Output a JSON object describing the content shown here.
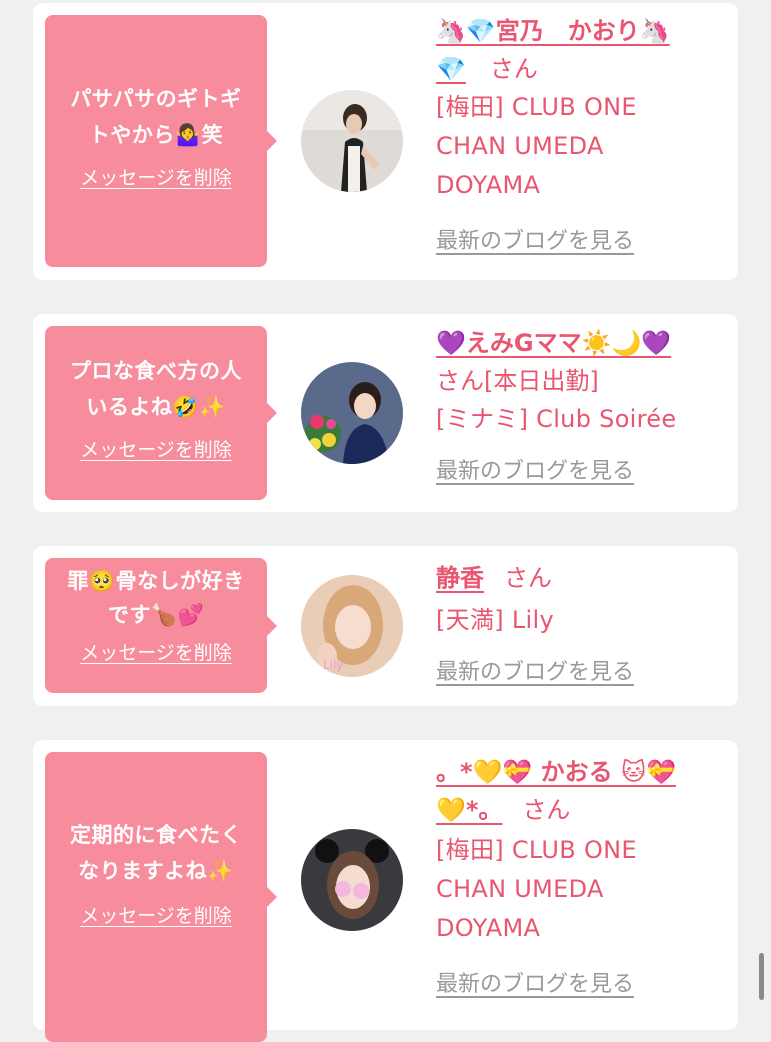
{
  "messages": [
    {
      "comment_lines": [
        "パサパサのギトギ",
        "トやから🤷‍♀️笑"
      ],
      "delete_label": "メッセージを削除",
      "name_lines": [
        "🦄💎宮乃　かおり🦄",
        "💎"
      ],
      "name_suffix": "さん",
      "shop_lines": [
        "[梅田] CLUB ONE",
        "CHAN UMEDA",
        "DOYAMA"
      ],
      "blog_link": "最新のブログを見る"
    },
    {
      "comment_lines": [
        "プロな食べ方の人",
        "いるよね🤣✨"
      ],
      "delete_label": "メッセージを削除",
      "name_lines": [
        "💜えみGママ☀️🌙💜"
      ],
      "name_suffix": "さん[本日出勤]",
      "shop_lines": [
        "[ミナミ] Club Soirée"
      ],
      "blog_link": "最新のブログを見る"
    },
    {
      "comment_lines": [
        "罪🥺骨なしが好き",
        "です🍗💕"
      ],
      "delete_label": "メッセージを削除",
      "name_lines": [
        "静香"
      ],
      "name_suffix": "さん",
      "shop_lines": [
        "[天満] Lily"
      ],
      "blog_link": "最新のブログを見る"
    },
    {
      "comment_lines": [
        "定期的に食べたく",
        "なりますよね✨"
      ],
      "delete_label": "メッセージを削除",
      "name_lines": [
        "。*💛💝 かおる 🐱💝",
        "💛*。"
      ],
      "name_suffix": "さん",
      "shop_lines": [
        "[梅田] CLUB ONE",
        "CHAN UMEDA",
        "DOYAMA"
      ],
      "blog_link": "最新のブログを見る"
    }
  ],
  "colors": {
    "page_background": "#f0f0f0",
    "card_background": "#ffffff",
    "bubble": "#f78c9c",
    "accent_text": "#e8566f",
    "muted_link": "#999999"
  }
}
